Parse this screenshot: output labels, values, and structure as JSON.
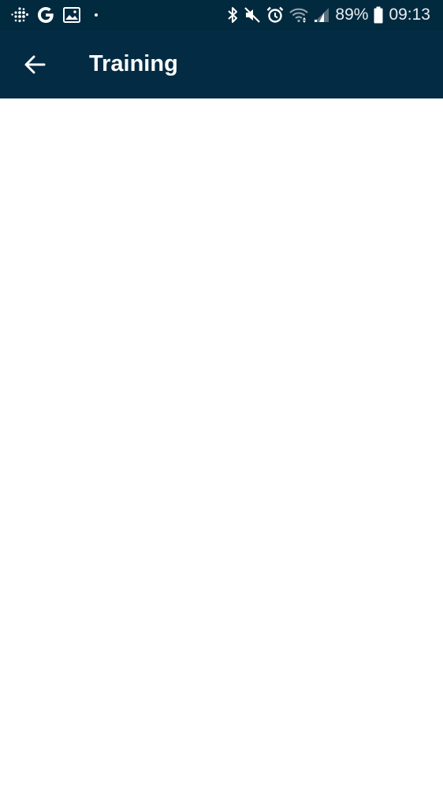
{
  "status_bar": {
    "left_icons": [
      "fitbit-icon",
      "google-icon",
      "gallery-icon",
      "notification-dot-icon"
    ],
    "right_icons": [
      "bluetooth-icon",
      "mute-icon",
      "alarm-icon",
      "wifi-icon",
      "signal-icon",
      "battery-icon"
    ],
    "battery": "89%",
    "time": "09:13"
  },
  "app_bar": {
    "title": "Training",
    "back_icon": "back-arrow-icon",
    "background_color": "#032b43"
  },
  "content": {}
}
